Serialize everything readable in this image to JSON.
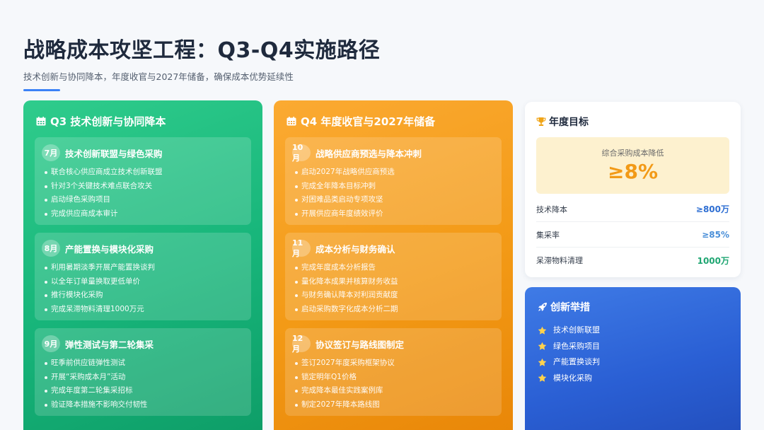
{
  "header": {
    "title": "战略成本攻坚工程：Q3-Q4实施路径",
    "subtitle": "技术创新与协同降本，年度收官与2027年储备，确保成本优势延续性"
  },
  "q3": {
    "title": "Q3 技术创新与协同降本",
    "icon": "calendar-icon",
    "months": [
      {
        "badge": "7月",
        "title": "技术创新联盟与绿色采购",
        "items": [
          "联合核心供应商成立技术创新联盟",
          "针对3个关键技术难点联合攻关",
          "启动绿色采购项目",
          "完成供应商成本审计"
        ]
      },
      {
        "badge": "8月",
        "title": "产能置换与模块化采购",
        "items": [
          "利用暑期淡季开展产能置换谈判",
          "以全年订单量换取更低单价",
          "推行模块化采购",
          "完成呆滞物料清理1000万元"
        ]
      },
      {
        "badge": "9月",
        "title": "弹性测试与第二轮集采",
        "items": [
          "旺季前供应链弹性测试",
          "开展“采购成本月”活动",
          "完成年度第二轮集采招标",
          "验证降本措施不影响交付韧性"
        ]
      }
    ]
  },
  "q4": {
    "title": "Q4 年度收官与2027年储备",
    "icon": "calendar-icon",
    "months": [
      {
        "badge": "10月",
        "title": "战略供应商预选与降本冲刺",
        "items": [
          "启动2027年战略供应商预选",
          "完成全年降本目标冲刺",
          "对困难品类启动专项攻坚",
          "开展供应商年度绩效评价"
        ]
      },
      {
        "badge": "11月",
        "title": "成本分析与财务确认",
        "items": [
          "完成年度成本分析报告",
          "量化降本成果并核算财务收益",
          "与财务确认降本对利润贡献度",
          "启动采购数字化成本分析二期"
        ]
      },
      {
        "badge": "12月",
        "title": "协议签订与路线图制定",
        "items": [
          "签订2027年度采购框架协议",
          "锁定明年Q1价格",
          "完成降本最佳实践案例库",
          "制定2027年降本路线图"
        ]
      }
    ]
  },
  "goals": {
    "title": "年度目标",
    "icon": "trophy-icon",
    "highlight_label": "综合采购成本降低",
    "highlight_value": "≥8%",
    "rows": [
      {
        "label": "技术降本",
        "value": "≥800万",
        "color": "#2f6fd3"
      },
      {
        "label": "集采率",
        "value": "≥85%",
        "color": "#4a8fd8"
      },
      {
        "label": "呆滞物料清理",
        "value": "1000万",
        "color": "#1fa672"
      }
    ]
  },
  "innovation": {
    "title": "创新举措",
    "icon": "rocket-icon",
    "items": [
      "技术创新联盟",
      "绿色采购项目",
      "产能置换谈判",
      "模块化采购"
    ]
  },
  "colors": {
    "q3_green": "#17b57a",
    "q4_orange": "#f39a16",
    "innovation_blue": "#2a5fd4",
    "highlight_orange": "#f29a17",
    "star_yellow": "#ffd24d"
  }
}
